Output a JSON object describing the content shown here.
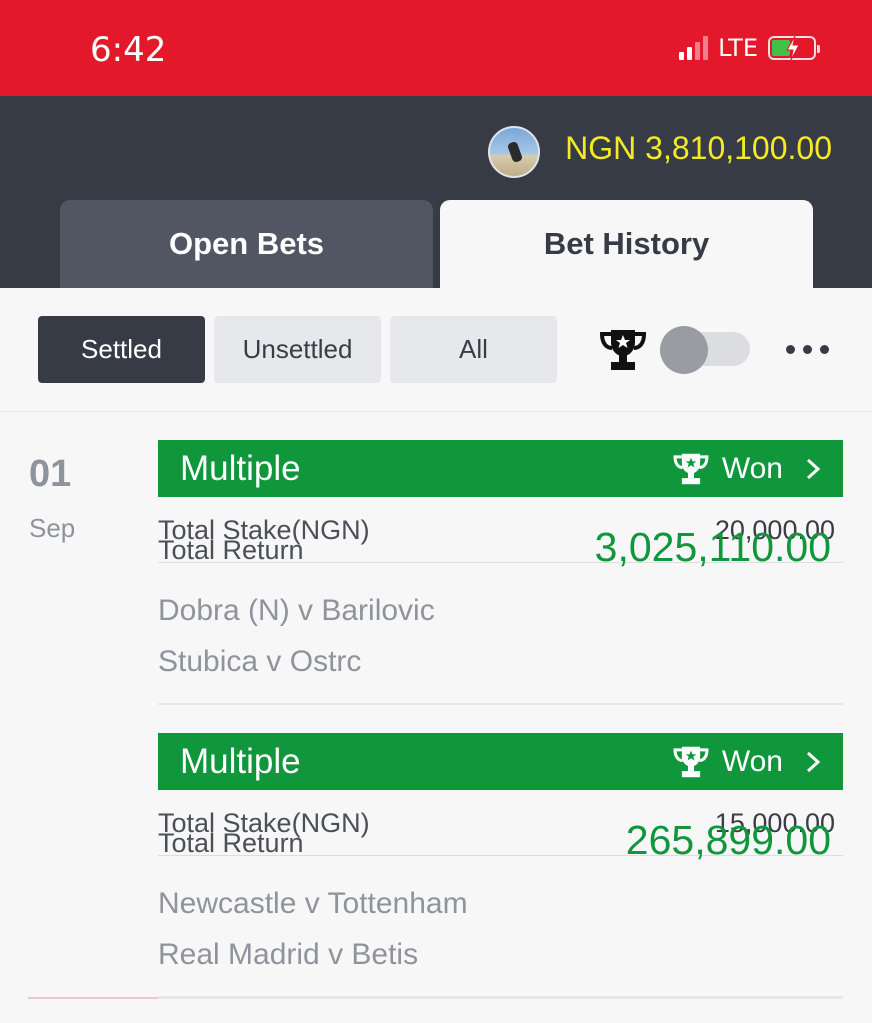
{
  "status_bar": {
    "time": "6:42",
    "network": "LTE",
    "icons": [
      "signal-icon",
      "battery-charging-icon"
    ]
  },
  "header": {
    "balance": "NGN 3,810,100.00",
    "balance_color": "#f4e925",
    "background": "#363b46",
    "tabs": [
      {
        "label": "Open Bets",
        "active": false
      },
      {
        "label": "Bet History",
        "active": true
      }
    ]
  },
  "filters": {
    "options": [
      {
        "label": "Settled",
        "selected": true
      },
      {
        "label": "Unsettled",
        "selected": false
      },
      {
        "label": "All",
        "selected": false
      }
    ],
    "won_only_toggle": false,
    "icons": [
      "trophy-icon",
      "more-icon"
    ]
  },
  "history": {
    "date": {
      "day": "01",
      "month": "Sep"
    },
    "bets": [
      {
        "type": "Multiple",
        "result": "Won",
        "stake_label": "Total Stake(NGN)",
        "stake": "20,000.00",
        "return_label": "Total Return",
        "return": "3,025,110.00",
        "matches": [
          "Dobra (N) v Barilovic",
          "Stubica v Ostrc"
        ]
      },
      {
        "type": "Multiple",
        "result": "Won",
        "stake_label": "Total Stake(NGN)",
        "stake": "15,000.00",
        "return_label": "Total Return",
        "return": "265,899.00",
        "matches": [
          "Newcastle v Tottenham",
          "Real Madrid v Betis"
        ]
      }
    ]
  },
  "colors": {
    "brand_red": "#e3192b",
    "won_green": "#10963b",
    "muted_text": "#8f939c"
  }
}
